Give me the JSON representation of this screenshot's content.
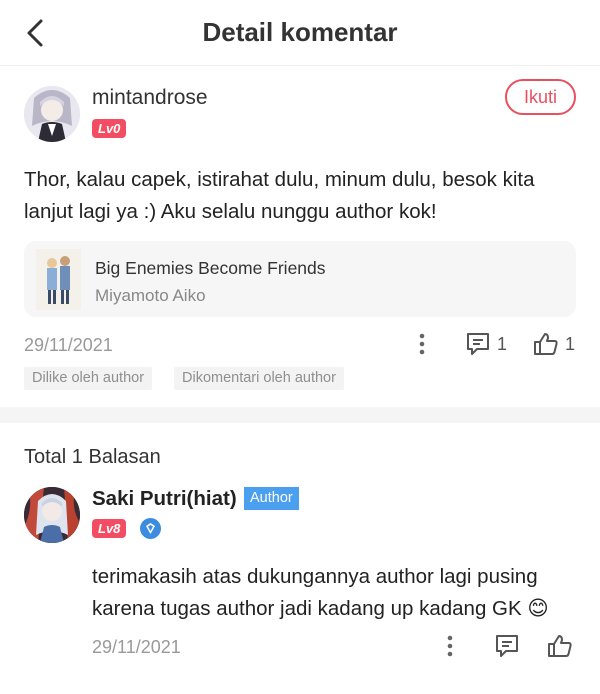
{
  "header": {
    "title": "Detail komentar",
    "back_icon": "chevron-left-icon"
  },
  "comment": {
    "username": "mintandrose",
    "level": "Lv0",
    "follow_label": "Ikuti",
    "text": "Thor, kalau capek, istirahat dulu, minum dulu, besok kita lanjut lagi ya :) Aku selalu nunggu author kok!",
    "book": {
      "title": "Big Enemies Become Friends",
      "author": "Miyamoto Aiko"
    },
    "date": "29/11/2021",
    "reply_count": "1",
    "like_count": "1",
    "tags": [
      "Dilike oleh author",
      "Dikomentari oleh author"
    ]
  },
  "replies": {
    "total_label": "Total 1 Balasan",
    "items": [
      {
        "username": "Saki Putri(hiat)",
        "badge": "Author",
        "level": "Lv8",
        "text": "terimakasih atas dukungannya author lagi pusing karena tugas author jadi kadang up kadang GK 😊",
        "date": "29/11/2021"
      }
    ]
  },
  "colors": {
    "accent_red": "#e8505f",
    "level_badge": "#f24d62",
    "author_badge": "#4aa0ee",
    "muted_text": "#999999"
  }
}
